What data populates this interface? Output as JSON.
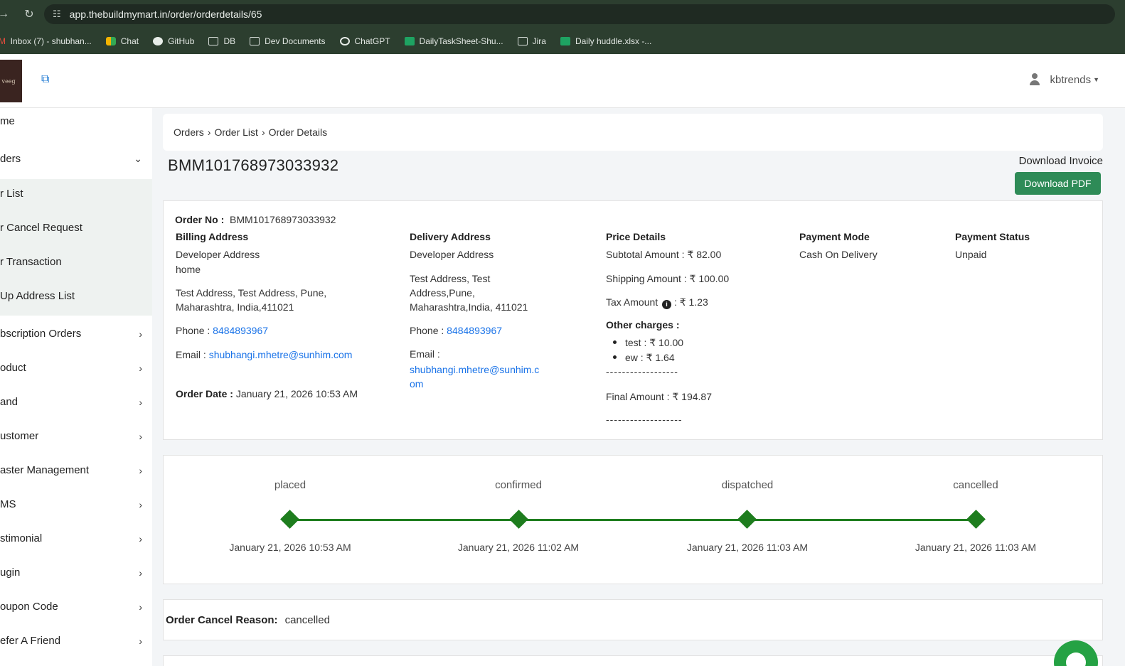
{
  "browser": {
    "url": "app.thebuildmymart.in/order/orderdetails/65",
    "bookmarks": [
      {
        "label": "Inbox (7) - shubhan...",
        "icon": "gmail-icon"
      },
      {
        "label": "Chat",
        "icon": "chat-icon"
      },
      {
        "label": "GitHub",
        "icon": "github-icon"
      },
      {
        "label": "DB",
        "icon": "folder-icon"
      },
      {
        "label": "Dev Documents",
        "icon": "folder-icon"
      },
      {
        "label": "ChatGPT",
        "icon": "chatgpt-icon"
      },
      {
        "label": "DailyTaskSheet-Shu...",
        "icon": "sheets-icon"
      },
      {
        "label": "Jira",
        "icon": "folder-icon"
      },
      {
        "label": "Daily huddle.xlsx -...",
        "icon": "sheets-icon"
      }
    ]
  },
  "header": {
    "username": "kbtrends"
  },
  "sidebar": {
    "items": [
      {
        "label": "me"
      },
      {
        "label": "ders"
      },
      {
        "label": "r List"
      },
      {
        "label": "r Cancel Request"
      },
      {
        "label": "r Transaction"
      },
      {
        "label": "Up Address List"
      },
      {
        "label": "bscription Orders"
      },
      {
        "label": "oduct"
      },
      {
        "label": "and"
      },
      {
        "label": "ustomer"
      },
      {
        "label": "aster Management"
      },
      {
        "label": "MS"
      },
      {
        "label": "stimonial"
      },
      {
        "label": "ugin"
      },
      {
        "label": "oupon Code"
      },
      {
        "label": "efer A Friend"
      }
    ]
  },
  "breadcrumb": [
    "Orders",
    "Order List",
    "Order Details"
  ],
  "order": {
    "id_title": "BMM101768973033932",
    "download_label": "Download Invoice",
    "download_button": "Download PDF",
    "order_no_label": "Order No :",
    "order_no": "BMM101768973033932",
    "billing": {
      "heading": "Billing Address",
      "name": "Developer Address",
      "type": "home",
      "address": "Test Address, Test Address, Pune, Maharashtra, India,411021",
      "phone_label": "Phone :",
      "phone": "8484893967",
      "email_label": "Email :",
      "email": "shubhangi.mhetre@sunhim.com",
      "order_date_label": "Order Date :",
      "order_date": "January 21, 2026 10:53 AM"
    },
    "delivery": {
      "heading": "Delivery Address",
      "name": "Developer Address",
      "address": "Test Address, Test Address,Pune, Maharashtra,India, 411021",
      "phone_label": "Phone :",
      "phone": "8484893967",
      "email_label": "Email :",
      "email": "shubhangi.mhetre@sunhim.com"
    },
    "price": {
      "heading": "Price Details",
      "subtotal": "Subtotal Amount : ₹ 82.00",
      "shipping": "Shipping Amount : ₹ 100.00",
      "tax_label": "Tax Amount",
      "tax_value": ": ₹  1.23",
      "other_label": "Other charges :",
      "other": [
        {
          "text": "test :  ₹  10.00"
        },
        {
          "text": "ew :  ₹  1.64"
        }
      ],
      "divider1": "------------------",
      "final": "Final Amount : ₹  194.87",
      "divider2": "-------------------"
    },
    "payment_mode": {
      "heading": "Payment Mode",
      "value": "Cash On Delivery"
    },
    "payment_status": {
      "heading": "Payment Status",
      "value": "Unpaid"
    }
  },
  "timeline": {
    "color": "#1e7d1e",
    "steps": [
      {
        "name": "placed",
        "date": "January 21, 2026 10:53 AM"
      },
      {
        "name": "confirmed",
        "date": "January 21, 2026 11:02 AM"
      },
      {
        "name": "dispatched",
        "date": "January 21, 2026 11:03 AM"
      },
      {
        "name": "cancelled",
        "date": "January 21, 2026 11:03 AM"
      }
    ]
  },
  "cancel_reason": {
    "label": "Order Cancel Reason:",
    "value": "cancelled"
  },
  "colors": {
    "accent": "#2e8b57",
    "link": "#1a73e8"
  }
}
